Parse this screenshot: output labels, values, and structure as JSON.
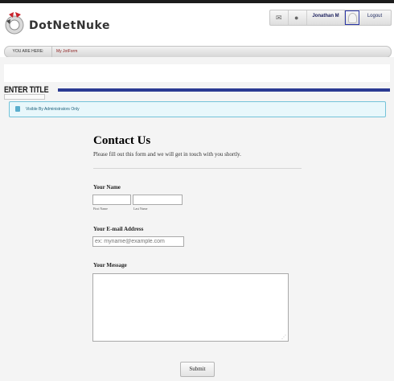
{
  "header": {
    "logo_text": "DotNetNuke",
    "user_bar": {
      "messages_icon": "envelope-icon",
      "notifications_icon": "info-circle-icon",
      "user_name": "Jonathan M",
      "avatar_icon": "user-avatar-icon",
      "logout_label": "Logout"
    }
  },
  "breadcrumb": {
    "label": "YOU ARE HERE:",
    "link": "My JotForm"
  },
  "section": {
    "title": "ENTER TITLE",
    "notice": "Visible By Administrators Only"
  },
  "form": {
    "title": "Contact Us",
    "subtitle": "Please fill out this form and we will get in touch with you shortly.",
    "name_label": "Your Name",
    "first_sublabel": "First Name",
    "last_sublabel": "Last Name",
    "email_label": "Your E-mail Address",
    "email_placeholder": "ex: myname@example.com",
    "message_label": "Your Message",
    "submit_label": "Submit"
  },
  "colors": {
    "title_rule": "#2b3b93",
    "notice_bg": "#e8f7fb",
    "breadcrumb_link": "#8c2020"
  }
}
